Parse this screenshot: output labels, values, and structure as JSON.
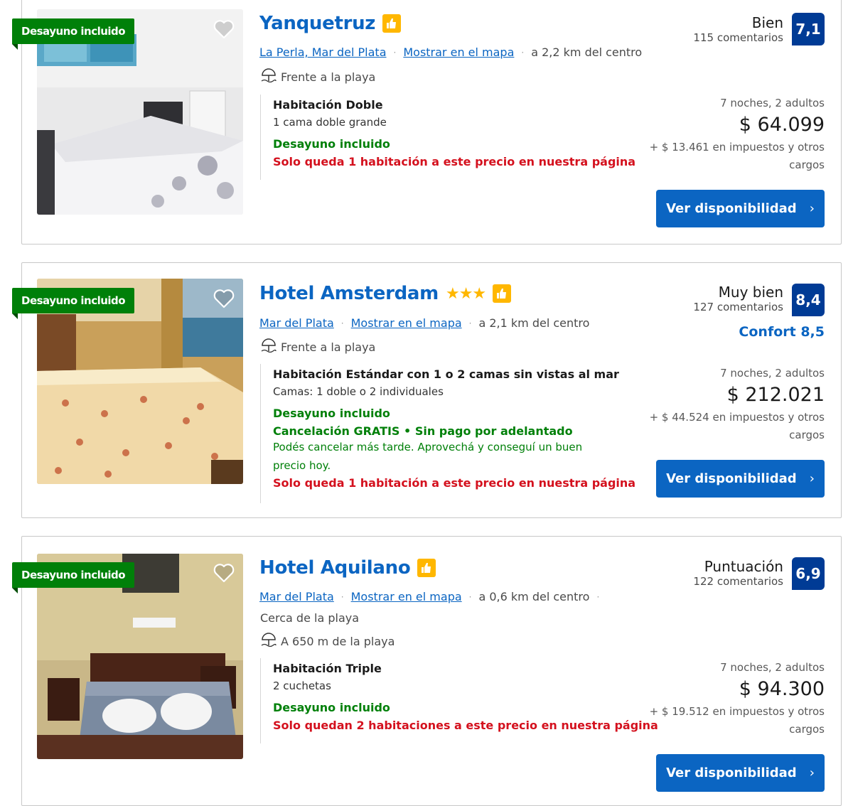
{
  "colors": {
    "accent_blue": "#0b65c2",
    "score_navy": "#003b95",
    "green": "#008009",
    "red": "#d4111e",
    "thumb_yellow": "#ffb700"
  },
  "hotels": [
    {
      "ribbon": "Desayuno incluido",
      "name": "Yanquetruz",
      "stars": "",
      "location": "La Perla, Mar del Plata",
      "map_link": "Mostrar en el mapa",
      "distance": "a 2,2 km del centro",
      "beach_text": "Frente a la playa",
      "room_title": "Habitación Doble",
      "room_sub": "1 cama doble grande",
      "breakfast": "Desayuno incluido",
      "scarcity": "Solo queda 1 habitación a este precio en nuestra página",
      "rating_label": "Bien",
      "rating_count": "115 comentarios",
      "score": "7,1",
      "stay": "7 noches, 2 adultos",
      "price": "$ 64.099",
      "taxes": "+ $ 13.461 en impuestos y otros cargos",
      "cta": "Ver disponibilidad"
    },
    {
      "ribbon": "Desayuno incluido",
      "name": "Hotel Amsterdam",
      "stars": "★★★",
      "location": "Mar del Plata",
      "map_link": "Mostrar en el mapa",
      "distance": "a 2,1 km del centro",
      "beach_text": "Frente a la playa",
      "room_title": "Habitación Estándar con 1 o 2 camas sin vistas al mar",
      "room_sub": "Camas: 1 doble o 2 individuales",
      "breakfast": "Desayuno incluido",
      "cancel": "Cancelación GRATIS • Sin pago por adelantado",
      "cancel_note": "Podés cancelar más tarde. Aprovechá y conseguí un buen precio hoy.",
      "scarcity": "Solo queda 1 habitación a este precio en nuestra página",
      "rating_label": "Muy bien",
      "rating_count": "127 comentarios",
      "score": "8,4",
      "comfort": "Confort 8,5",
      "stay": "7 noches, 2 adultos",
      "price": "$ 212.021",
      "taxes": "+ $ 44.524 en impuestos y otros cargos",
      "cta": "Ver disponibilidad"
    },
    {
      "ribbon": "Desayuno incluido",
      "name": "Hotel Aquilano",
      "stars": "",
      "location": "Mar del Plata",
      "map_link": "Mostrar en el mapa",
      "distance": "a 0,6 km del centro",
      "near_beach": "Cerca de la playa",
      "beach_text": "A 650 m de la playa",
      "room_title": "Habitación Triple",
      "room_sub": "2 cuchetas",
      "breakfast": "Desayuno incluido",
      "scarcity": "Solo quedan 2 habitaciones a este precio en nuestra página",
      "rating_label": "Puntuación",
      "rating_count": "122 comentarios",
      "score": "6,9",
      "stay": "7 noches, 2 adultos",
      "price": "$ 94.300",
      "taxes": "+ $ 19.512 en impuestos y otros cargos",
      "cta": "Ver disponibilidad"
    }
  ]
}
